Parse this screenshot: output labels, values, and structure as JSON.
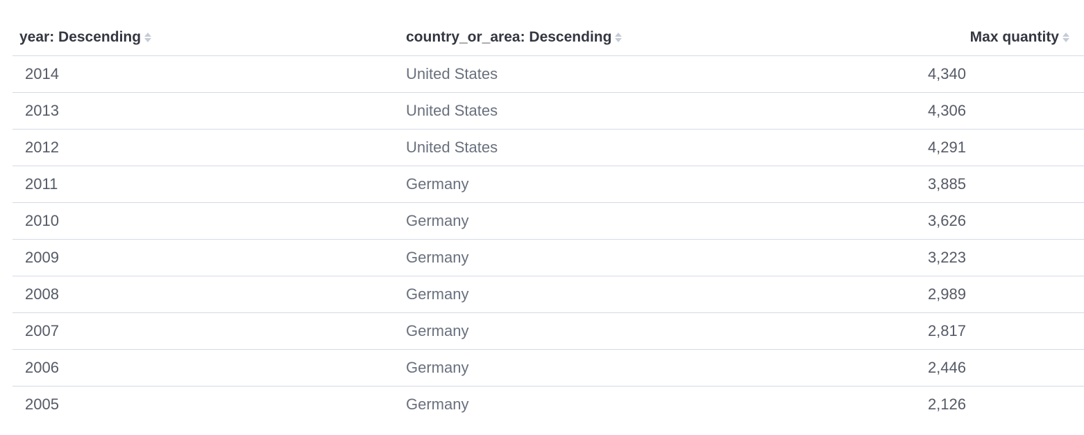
{
  "table": {
    "headers": {
      "year": "year: Descending",
      "country": "country_or_area: Descending",
      "quantity": "Max quantity"
    },
    "rows": [
      {
        "year": "2014",
        "country": "United States",
        "quantity": "4,340"
      },
      {
        "year": "2013",
        "country": "United States",
        "quantity": "4,306"
      },
      {
        "year": "2012",
        "country": "United States",
        "quantity": "4,291"
      },
      {
        "year": "2011",
        "country": "Germany",
        "quantity": "3,885"
      },
      {
        "year": "2010",
        "country": "Germany",
        "quantity": "3,626"
      },
      {
        "year": "2009",
        "country": "Germany",
        "quantity": "3,223"
      },
      {
        "year": "2008",
        "country": "Germany",
        "quantity": "2,989"
      },
      {
        "year": "2007",
        "country": "Germany",
        "quantity": "2,817"
      },
      {
        "year": "2006",
        "country": "Germany",
        "quantity": "2,446"
      },
      {
        "year": "2005",
        "country": "Germany",
        "quantity": "2,126"
      }
    ]
  },
  "icons": {
    "sort": "sort-arrows-icon"
  },
  "colors": {
    "header_text": "#343741",
    "cell_text": "#555a66",
    "divider": "#d3dae6",
    "sort_icon": "#c5ccd7"
  }
}
